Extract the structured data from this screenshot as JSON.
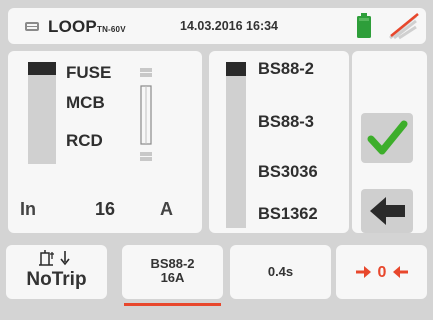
{
  "status_bar": {
    "title": "LOOP",
    "title_sub": "TN-60V",
    "datetime": "14.03.2016 16:34",
    "battery_icon": "battery-icon",
    "signal_icon": "signal-off-icon"
  },
  "device_types": {
    "options": [
      "FUSE",
      "MCB",
      "RCD"
    ],
    "selected": "FUSE"
  },
  "nominal_current": {
    "label": "In",
    "value": "16",
    "unit": "A"
  },
  "standards": {
    "options": [
      "BS88-2",
      "BS88-3",
      "BS3036",
      "BS1362"
    ],
    "selected": "BS88-2"
  },
  "side_buttons": {
    "confirm_icon": "checkmark-icon",
    "back_icon": "arrow-left-icon"
  },
  "tabs": {
    "notrip": {
      "icon": "notrip-icon",
      "label": "NoTrip"
    },
    "standard": {
      "line1": "BS88-2",
      "line2": "16A"
    },
    "time": {
      "label": "0.4s"
    },
    "zero": {
      "label": "0",
      "icon": "zero-calibration-icon"
    }
  },
  "colors": {
    "accent_red": "#e8472c",
    "check_green": "#3dae2b",
    "battery_green": "#2e9e3a"
  }
}
